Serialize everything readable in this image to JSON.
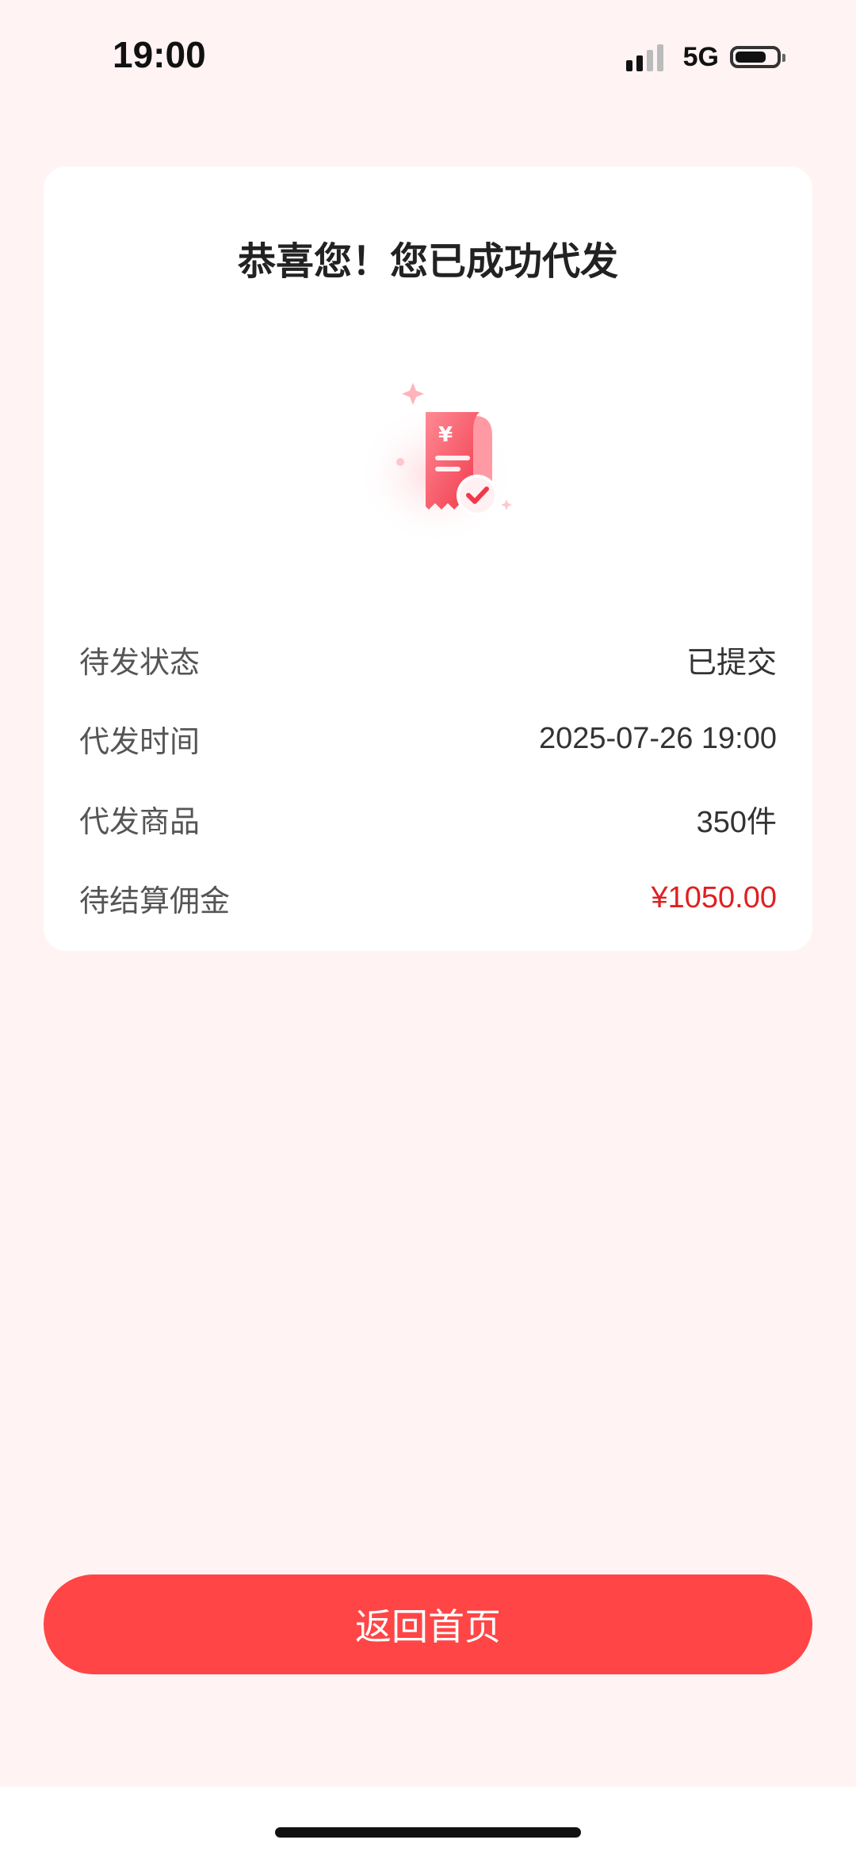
{
  "status_bar": {
    "time": "19:00",
    "network": "5G",
    "battery_icon": "battery-icon",
    "signal_icon": "signal-icon"
  },
  "card": {
    "title": "恭喜您！您已成功代发",
    "illustration_icon": "receipt-check-icon",
    "rows": [
      {
        "label": "待发状态",
        "value": "已提交"
      },
      {
        "label": "代发时间",
        "value": "2025-07-26 19:00"
      },
      {
        "label": "代发商品",
        "value": "350件"
      },
      {
        "label": "待结算佣金",
        "value": "¥1050.00"
      }
    ]
  },
  "button": {
    "label": "返回首页"
  },
  "colors": {
    "accent": "#ff4545",
    "commission": "#e02020",
    "background": "#fff3f4"
  }
}
